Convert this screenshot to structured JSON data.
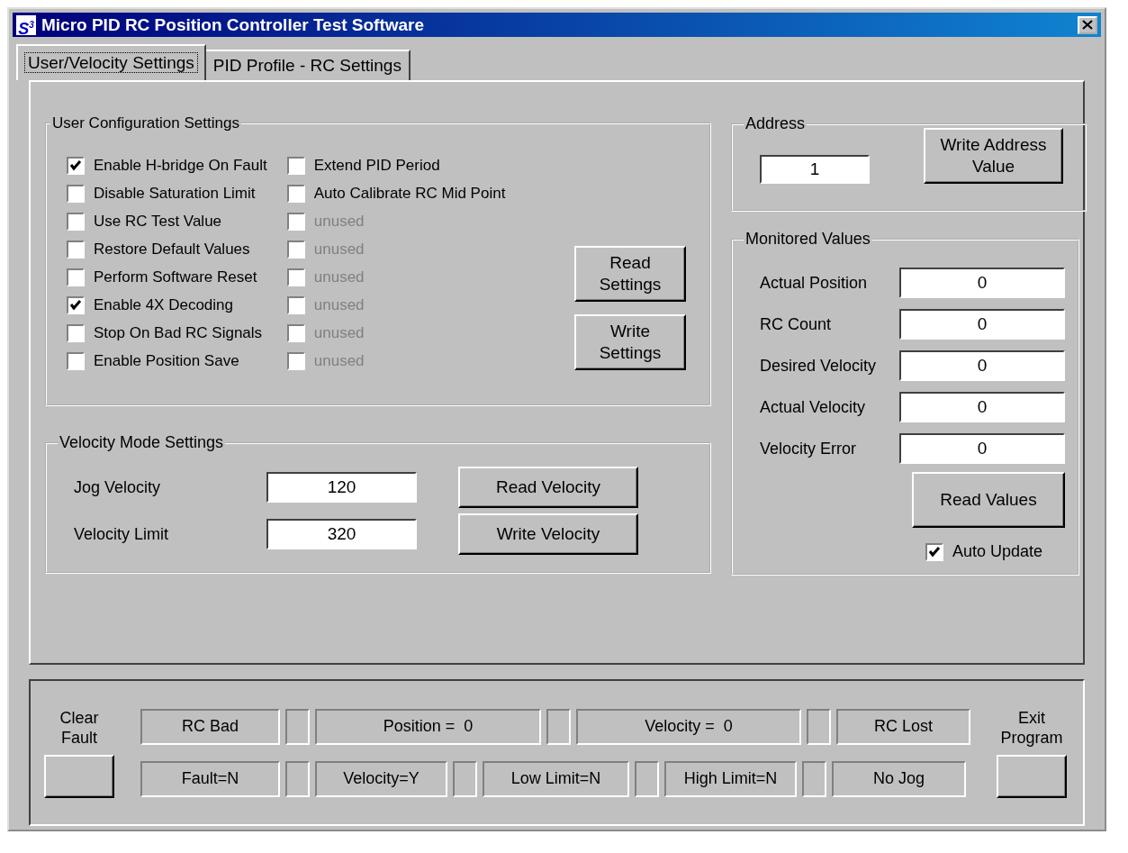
{
  "window": {
    "icon_text": "S$^{3}$",
    "title": "Micro PID RC Position Controller Test Software"
  },
  "tabs": [
    {
      "label": "User/Velocity Settings",
      "selected": true
    },
    {
      "label": "PID Profile - RC Settings",
      "selected": false
    }
  ],
  "user_config": {
    "title": "User Configuration Settings",
    "left_options": [
      {
        "label": "Enable H-bridge On Fault",
        "checked": true,
        "disabled": false
      },
      {
        "label": "Disable Saturation Limit",
        "checked": false,
        "disabled": false
      },
      {
        "label": "Use RC Test Value",
        "checked": false,
        "disabled": false
      },
      {
        "label": "Restore Default Values",
        "checked": false,
        "disabled": false
      },
      {
        "label": "Perform Software Reset",
        "checked": false,
        "disabled": false
      },
      {
        "label": "Enable 4X Decoding",
        "checked": true,
        "disabled": false
      },
      {
        "label": "Stop On Bad RC Signals",
        "checked": false,
        "disabled": false
      },
      {
        "label": "Enable Position Save",
        "checked": false,
        "disabled": false
      }
    ],
    "right_options": [
      {
        "label": "Extend PID Period",
        "checked": false,
        "disabled": false
      },
      {
        "label": "Auto Calibrate RC Mid Point",
        "checked": false,
        "disabled": false
      },
      {
        "label": "unused",
        "checked": false,
        "disabled": true
      },
      {
        "label": "unused",
        "checked": false,
        "disabled": true
      },
      {
        "label": "unused",
        "checked": false,
        "disabled": true
      },
      {
        "label": "unused",
        "checked": false,
        "disabled": true
      },
      {
        "label": "unused",
        "checked": false,
        "disabled": true
      },
      {
        "label": "unused",
        "checked": false,
        "disabled": true
      }
    ],
    "buttons": [
      "Read Settings",
      "Write Settings"
    ]
  },
  "velocity": {
    "title": "Velocity Mode Settings",
    "fields": [
      {
        "label": "Jog Velocity",
        "value": "120"
      },
      {
        "label": "Velocity Limit",
        "value": "320"
      }
    ],
    "buttons": [
      "Read Velocity",
      "Write Velocity"
    ]
  },
  "address": {
    "title": "Address",
    "value": "1",
    "button": "Write Address Value"
  },
  "monitored": {
    "title": "Monitored Values",
    "fields": [
      {
        "label": "Actual Position",
        "value": "0"
      },
      {
        "label": "RC Count",
        "value": "0"
      },
      {
        "label": "Desired Velocity",
        "value": "0"
      },
      {
        "label": "Actual Velocity",
        "value": "0"
      },
      {
        "label": "Velocity Error",
        "value": "0"
      }
    ],
    "button": "Read Values",
    "auto_update": {
      "label": "Auto Update",
      "checked": true
    }
  },
  "status_bar": {
    "clear_fault_label": "Clear Fault",
    "exit_label": "Exit Program",
    "row_1": [
      {
        "kind": "text",
        "text": "RC Bad"
      },
      {
        "kind": "spacer"
      },
      {
        "kind": "text",
        "text": "Position =  0"
      },
      {
        "kind": "spacer"
      },
      {
        "kind": "text",
        "text": "Velocity =  0"
      },
      {
        "kind": "spacer"
      },
      {
        "kind": "text",
        "text": "RC Lost"
      }
    ],
    "row_2": [
      {
        "kind": "text",
        "text": "Fault=N"
      },
      {
        "kind": "spacer"
      },
      {
        "kind": "text",
        "text": "Velocity=Y"
      },
      {
        "kind": "spacer"
      },
      {
        "kind": "text",
        "text": "Low Limit=N"
      },
      {
        "kind": "spacer"
      },
      {
        "kind": "text",
        "text": "High Limit=N"
      },
      {
        "kind": "spacer"
      },
      {
        "kind": "text",
        "text": "No Jog"
      }
    ]
  }
}
